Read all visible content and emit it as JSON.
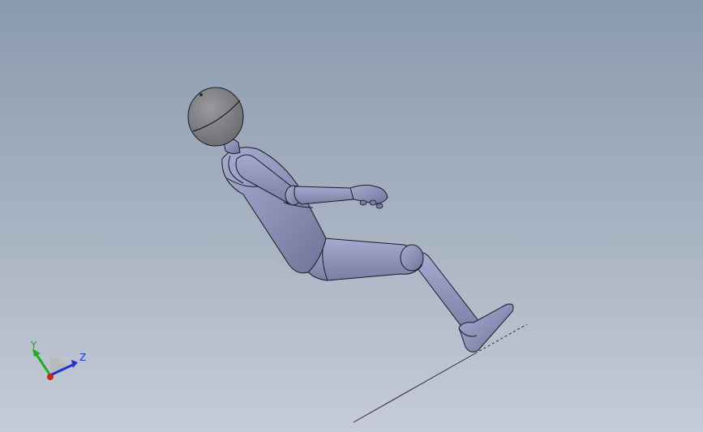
{
  "viewport": {
    "model": "seated-mannequin",
    "view_orientation": "isometric"
  },
  "triad": {
    "y_label": "Y",
    "z_label": "Z",
    "colors": {
      "x_axis": "#cc2222",
      "y_axis": "#22aa22",
      "z_axis": "#2233cc"
    }
  },
  "colors": {
    "background_top": "#8a9aae",
    "background_bottom": "#c6ccd7",
    "body_fill": "#8f93b8",
    "body_edge": "#1a1a22"
  }
}
